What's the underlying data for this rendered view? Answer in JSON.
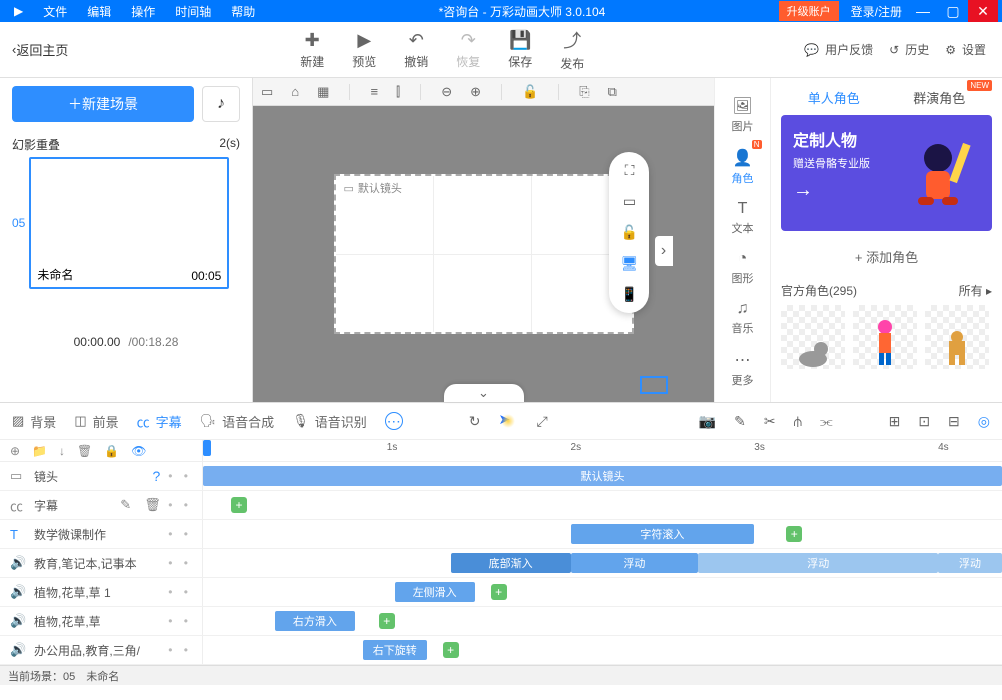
{
  "title_bar": {
    "menus": [
      "文件",
      "编辑",
      "操作",
      "时间轴",
      "帮助"
    ],
    "title": "*咨询台 - 万彩动画大师 3.0.104",
    "upgrade": "升级账户",
    "login": "登录/注册"
  },
  "toolbar": {
    "back": "返回主页",
    "new": "新建",
    "preview": "预览",
    "undo": "撤销",
    "redo": "恢复",
    "save": "保存",
    "publish": "发布",
    "feedback": "用户反馈",
    "history": "历史",
    "settings": "设置"
  },
  "left": {
    "new_scene": "新建场景",
    "overlay_label": "幻影重叠",
    "overlay_time": "2(s)",
    "scene_index": "05",
    "scene_name": "未命名",
    "scene_duration": "00:05",
    "current_time": "00:00.00",
    "total_time": "/00:18.28"
  },
  "canvas": {
    "default_camera": "默认镜头"
  },
  "rail": {
    "image": "图片",
    "character": "角色",
    "text": "文本",
    "shape": "图形",
    "music": "音乐",
    "more": "更多"
  },
  "right_panel": {
    "tab_single": "单人角色",
    "tab_crowd": "群演角色",
    "promo_title": "定制人物",
    "promo_sub": "赠送骨骼专业版",
    "add_character": "+ 添加角色",
    "official_label": "官方角色(295)",
    "filter_all": "所有 ▸"
  },
  "timeline_bar": {
    "bg": "背景",
    "fg": "前景",
    "subtitle": "字幕",
    "tts": "语音合成",
    "asr": "语音识别"
  },
  "ruler": {
    "t1": "1s",
    "t2": "2s",
    "t3": "3s",
    "t4": "4s"
  },
  "tracks": {
    "camera": {
      "name": "镜头",
      "clip": "默认镜头"
    },
    "subtitle": {
      "name": "字幕"
    },
    "text": {
      "name": "数学微课制作",
      "clip": "字符滚入"
    },
    "sound1": {
      "name": "教育,笔记本,记事本",
      "clip_in": "底部渐入",
      "float1": "浮动",
      "float2": "浮动",
      "float3": "浮动"
    },
    "sound2": {
      "name": "植物,花草,草 1",
      "clip_in": "左侧滑入"
    },
    "sound3": {
      "name": "植物,花草,草",
      "clip_in": "右方滑入"
    },
    "sound4": {
      "name": "办公用品,教育,三角/",
      "clip_in": "右下旋转"
    }
  },
  "status": {
    "text": "当前场景：05　未命名"
  }
}
